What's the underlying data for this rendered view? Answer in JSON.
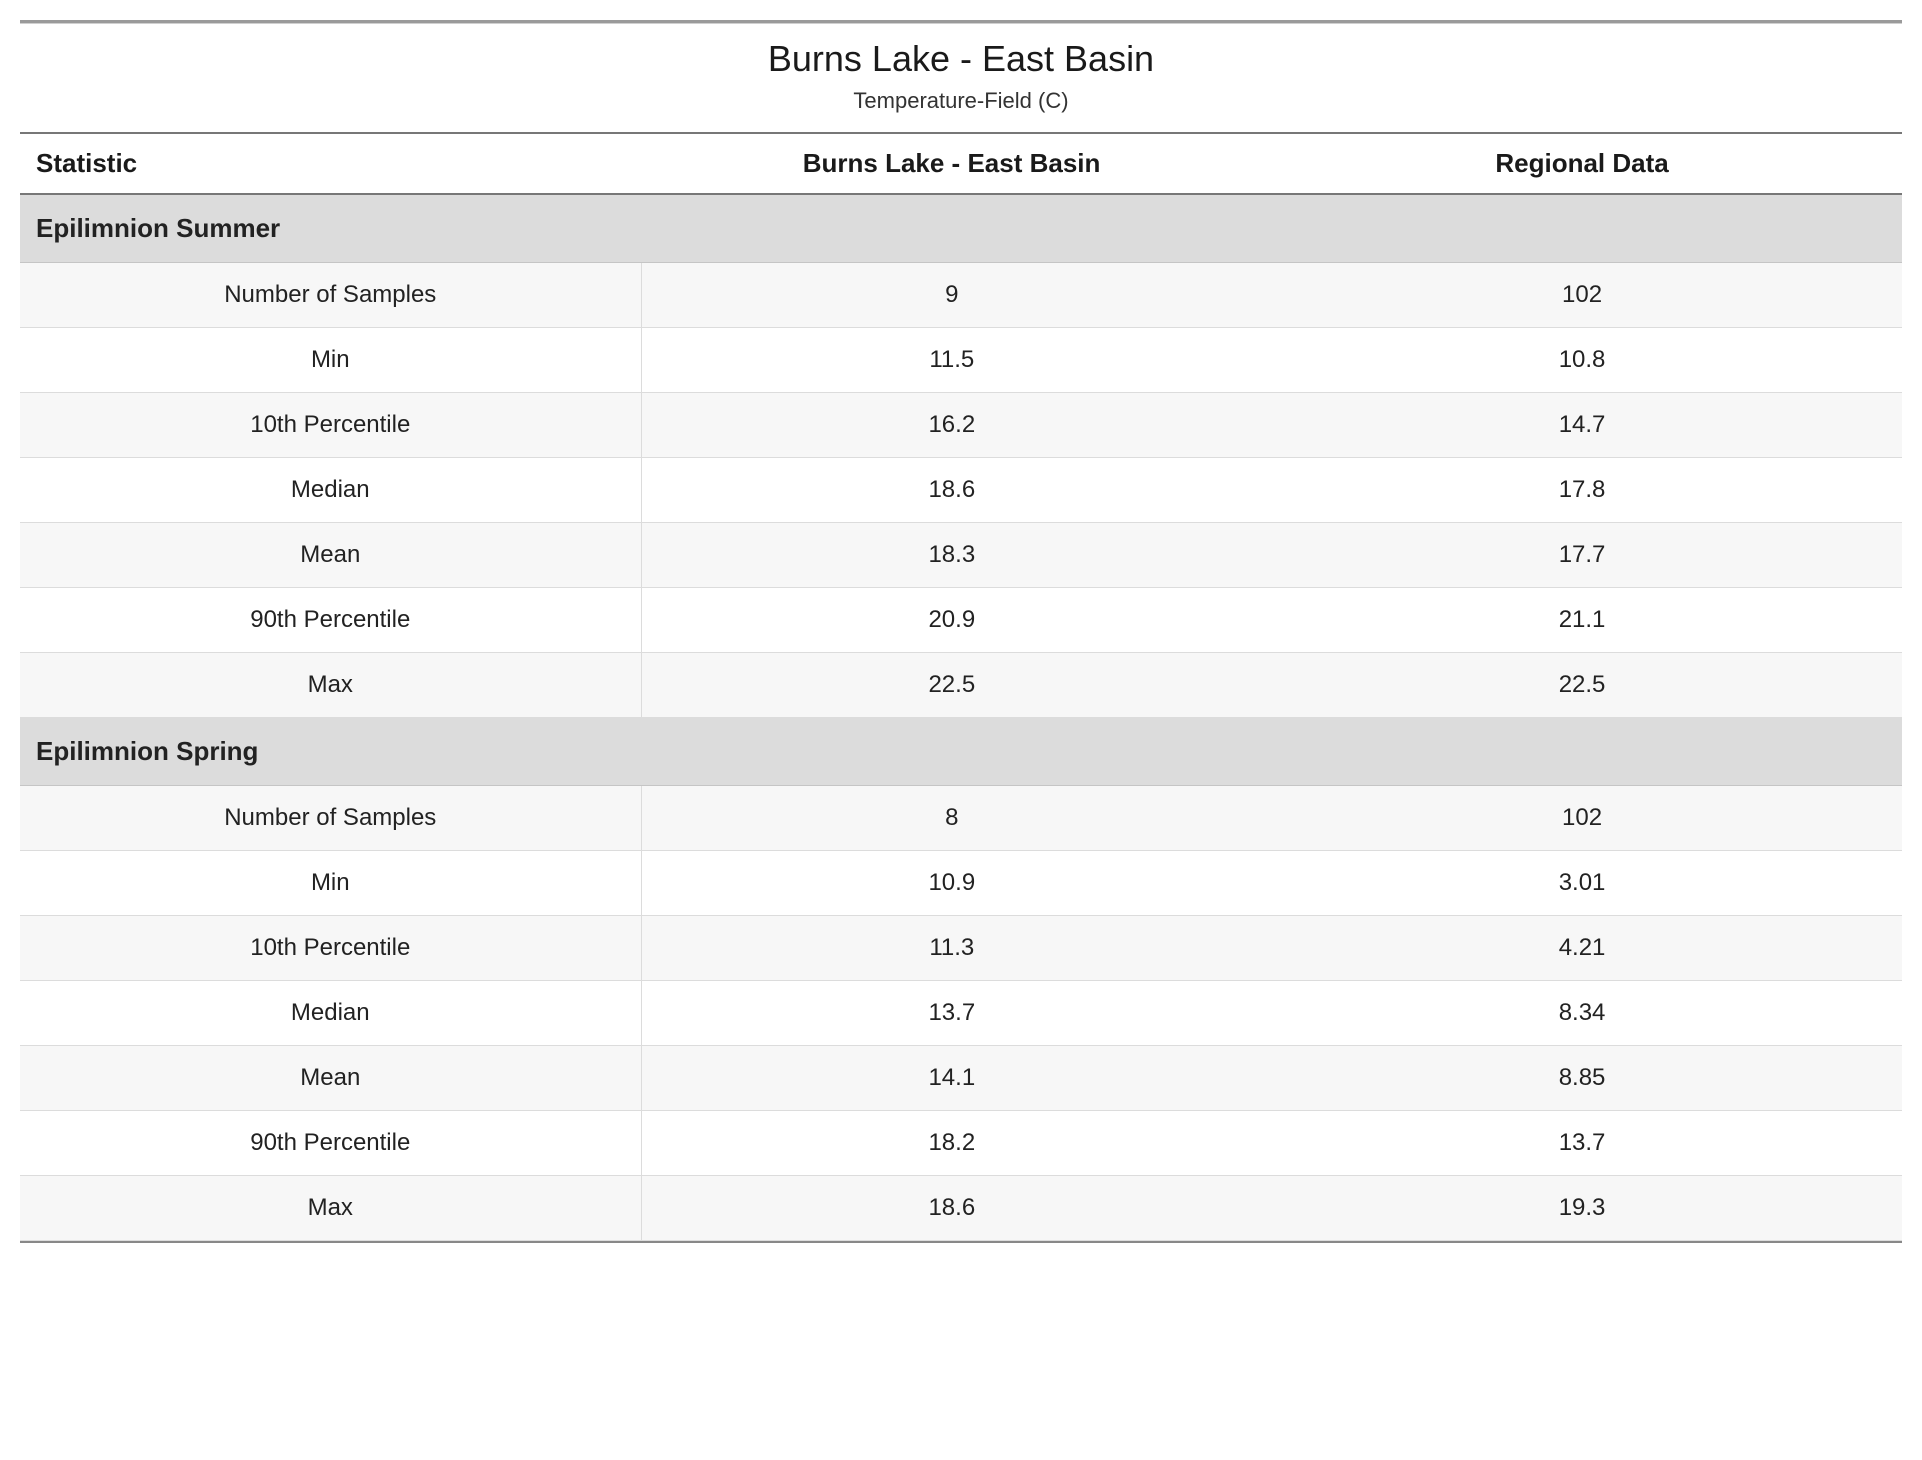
{
  "header": {
    "title": "Burns Lake - East Basin",
    "subtitle": "Temperature-Field (C)"
  },
  "columns": {
    "stat": "Statistic",
    "site": "Burns Lake - East Basin",
    "region": "Regional Data"
  },
  "sections": [
    {
      "label": "Epilimnion Summer",
      "rows": [
        {
          "stat": "Number of Samples",
          "site": "9",
          "region": "102"
        },
        {
          "stat": "Min",
          "site": "11.5",
          "region": "10.8"
        },
        {
          "stat": "10th Percentile",
          "site": "16.2",
          "region": "14.7"
        },
        {
          "stat": "Median",
          "site": "18.6",
          "region": "17.8"
        },
        {
          "stat": "Mean",
          "site": "18.3",
          "region": "17.7"
        },
        {
          "stat": "90th Percentile",
          "site": "20.9",
          "region": "21.1"
        },
        {
          "stat": "Max",
          "site": "22.5",
          "region": "22.5"
        }
      ]
    },
    {
      "label": "Epilimnion Spring",
      "rows": [
        {
          "stat": "Number of Samples",
          "site": "8",
          "region": "102"
        },
        {
          "stat": "Min",
          "site": "10.9",
          "region": "3.01"
        },
        {
          "stat": "10th Percentile",
          "site": "11.3",
          "region": "4.21"
        },
        {
          "stat": "Median",
          "site": "13.7",
          "region": "8.34"
        },
        {
          "stat": "Mean",
          "site": "14.1",
          "region": "8.85"
        },
        {
          "stat": "90th Percentile",
          "site": "18.2",
          "region": "13.7"
        },
        {
          "stat": "Max",
          "site": "18.6",
          "region": "19.3"
        }
      ]
    }
  ]
}
